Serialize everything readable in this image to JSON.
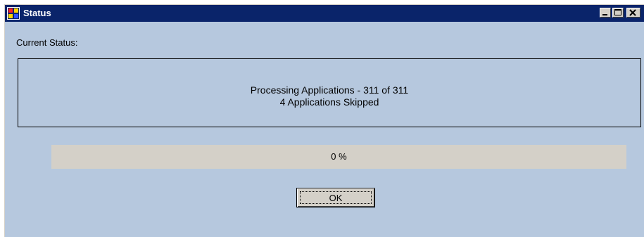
{
  "window": {
    "title": "Status",
    "icon": "app-window-icon",
    "buttons": [
      "minimize-icon",
      "maximize-icon",
      "close-icon"
    ]
  },
  "content": {
    "current_status_label": "Current Status:",
    "status_line_1": "Processing Applications - 311 of 311",
    "status_line_2": "4 Applications Skipped"
  },
  "progress": {
    "value_percent": 0,
    "label": "0 %"
  },
  "actions": {
    "ok_label": "OK"
  },
  "colors": {
    "titlebar": "#0a246a",
    "window_bg": "#b6c8de",
    "button_face": "#d4d0c8"
  }
}
